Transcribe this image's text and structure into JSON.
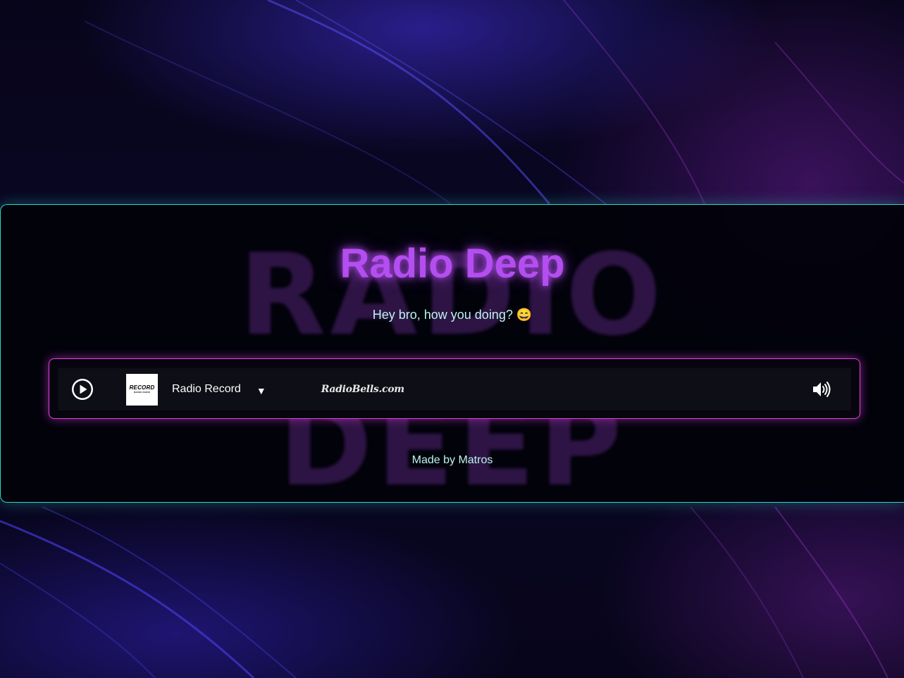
{
  "page": {
    "title": "Radio Deep",
    "subtitle": "Hey bro, how you doing?",
    "subtitle_emoji": "😄",
    "watermark_line1": "RADIO",
    "watermark_line2": "DEEP",
    "footer": "Made by Matros"
  },
  "player": {
    "play_icon": "play-icon",
    "station_logo_text": "RECORD",
    "station_logo_subtext": "DANCE RADIO",
    "station_name": "Radio Record",
    "dropdown_icon": "▼",
    "brand": "RadioBells.com",
    "volume_icon": "volume-icon"
  },
  "colors": {
    "title": "#b44ef0",
    "panel_border": "#2fd6c2",
    "player_border": "#e43fe4",
    "text_accent": "#bdf4ee"
  }
}
